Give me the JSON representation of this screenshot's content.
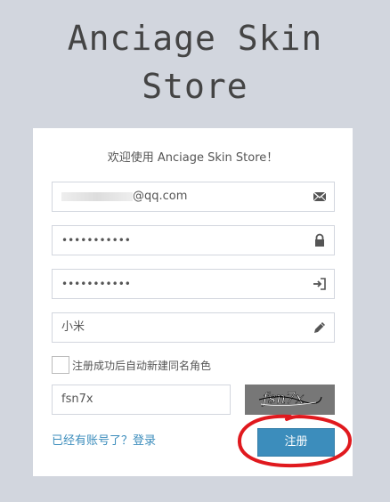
{
  "header": {
    "title_line1": "Anciage Skin",
    "title_line2": "Store"
  },
  "form": {
    "welcome": "欢迎使用 Anciage Skin Store！",
    "email_suffix": "@qq.com",
    "password": "•••••••••••",
    "password_confirm": "•••••••••••",
    "nickname": "小米",
    "checkbox_label": "注册成功后自动新建同名角色",
    "captcha_value": "fsn7x",
    "captcha_image_text": "fsn7x",
    "login_link": "已经有账号了？登录",
    "register_label": "注册"
  },
  "colors": {
    "accent": "#3c8dbc",
    "background": "#d2d6de",
    "annotation": "#e0191e"
  },
  "icons": [
    "envelope-icon",
    "lock-icon",
    "sign-in-icon",
    "pencil-icon"
  ]
}
